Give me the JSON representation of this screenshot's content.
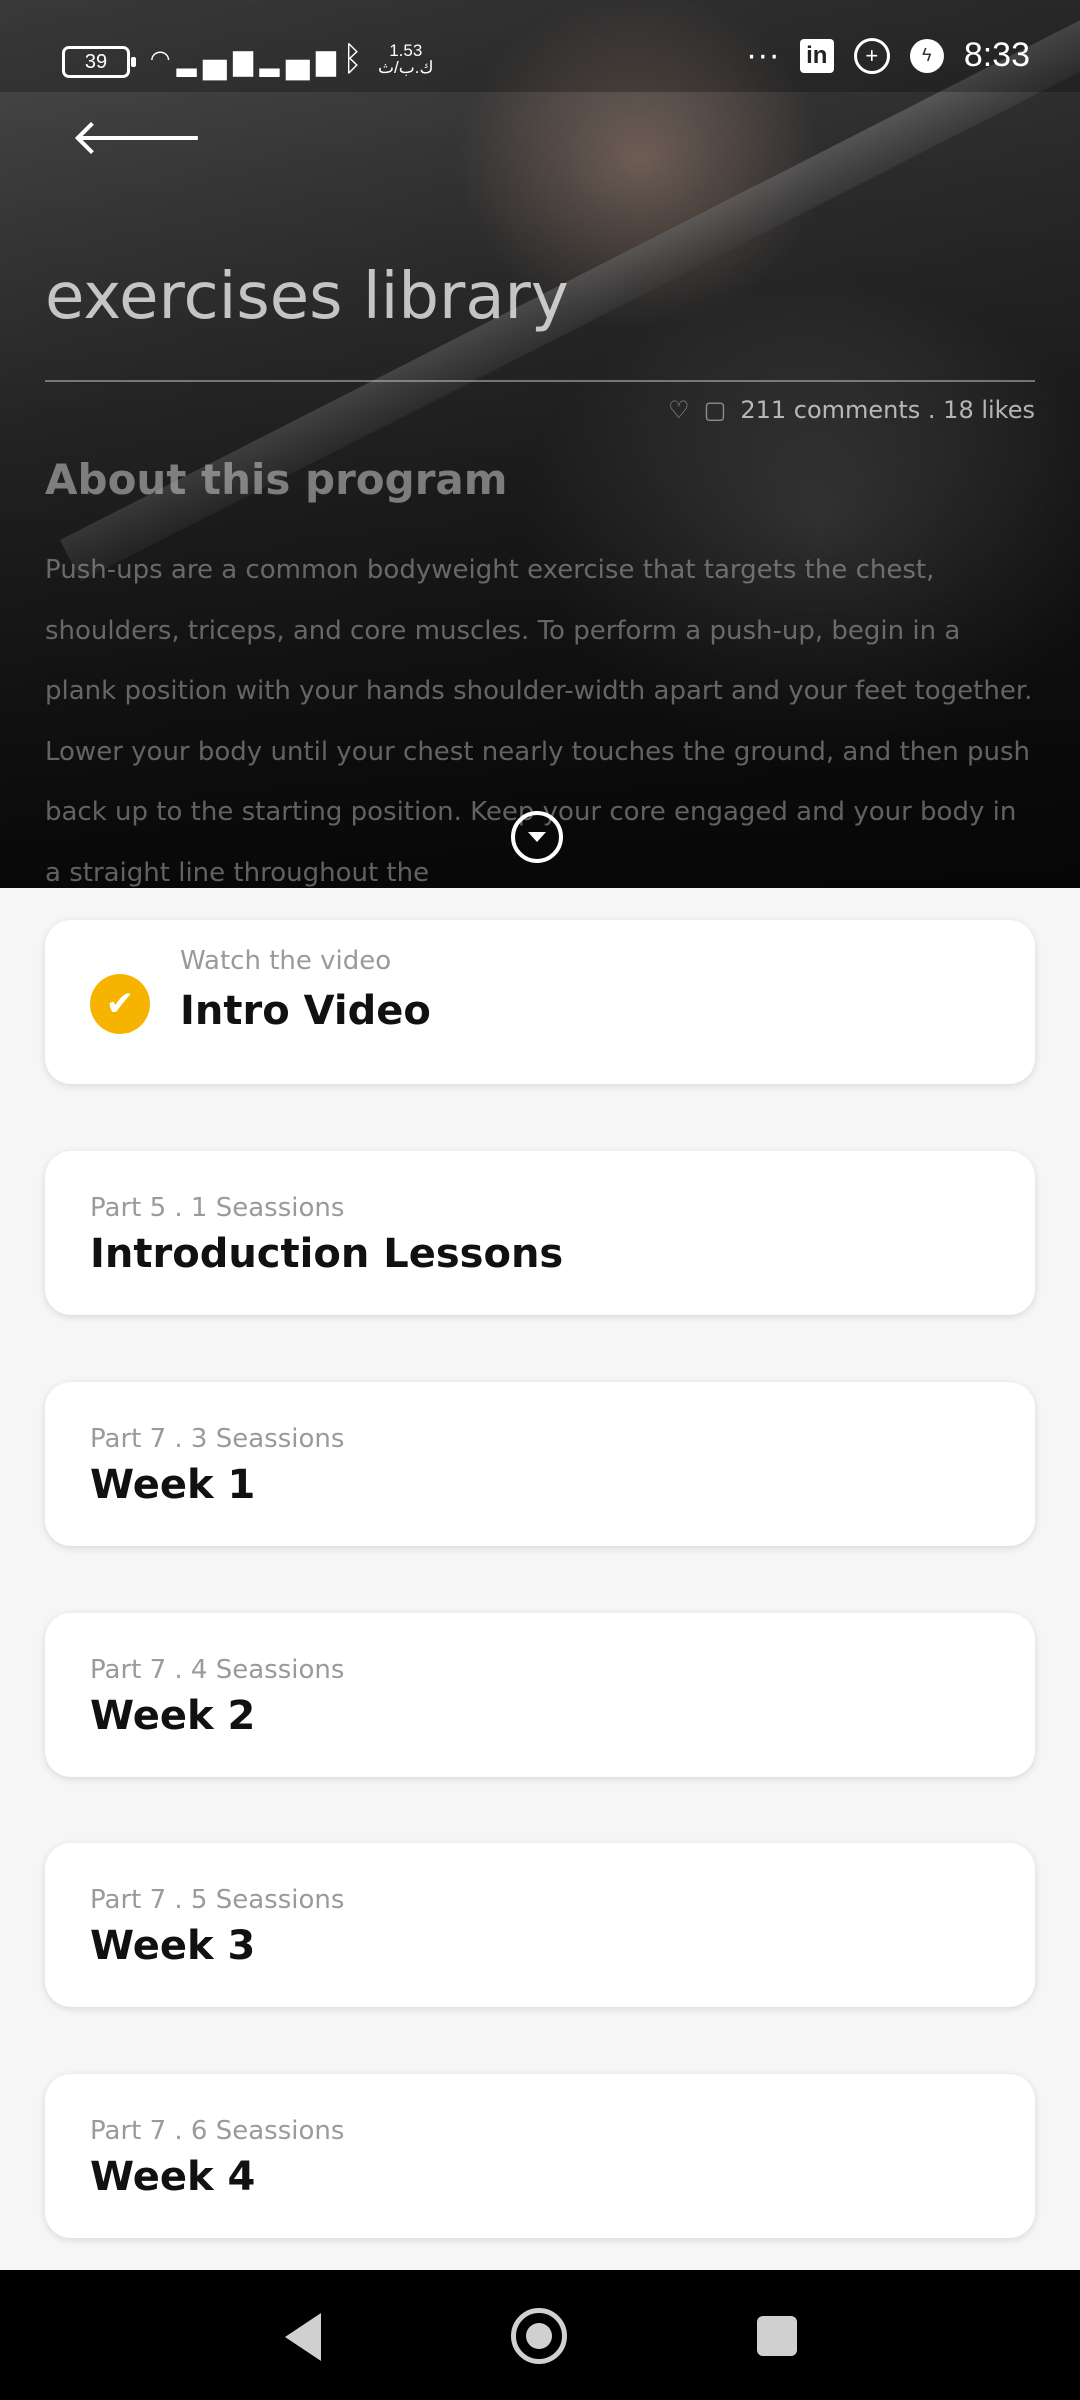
{
  "status": {
    "battery": "39",
    "net_speed": "1.53",
    "net_unit": "ك.ب/ث",
    "time": "8:33",
    "more": "···",
    "linkedin": "in"
  },
  "header": {
    "title": "exercises library",
    "stats": "211 comments . 18 likes",
    "about_title": "About this program",
    "description": "Push-ups are a common bodyweight exercise that targets the chest, shoulders, triceps, and core muscles. To perform a push-up, begin in a plank position with your hands shoulder-width apart and your feet together. Lower your body until your chest nearly touches the ground, and then push back up to the starting position. Keep your core engaged and your body in a straight line throughout the"
  },
  "video_card": {
    "subtitle": "Watch the video",
    "title": "Intro Video"
  },
  "parts": [
    {
      "subtitle": "Part 5 . 1 Seassions",
      "title": "Introduction Lessons"
    },
    {
      "subtitle": "Part 7 . 3 Seassions",
      "title": "Week 1"
    },
    {
      "subtitle": "Part 7 . 4 Seassions",
      "title": "Week 2"
    },
    {
      "subtitle": "Part 7 . 5 Seassions",
      "title": "Week 3"
    },
    {
      "subtitle": "Part 7 . 6 Seassions",
      "title": "Week 4"
    }
  ],
  "colors": {
    "accent": "#f6b400",
    "card_bg": "#ffffff",
    "page_bg": "#f6f6f6",
    "nav_bg": "#000000"
  }
}
